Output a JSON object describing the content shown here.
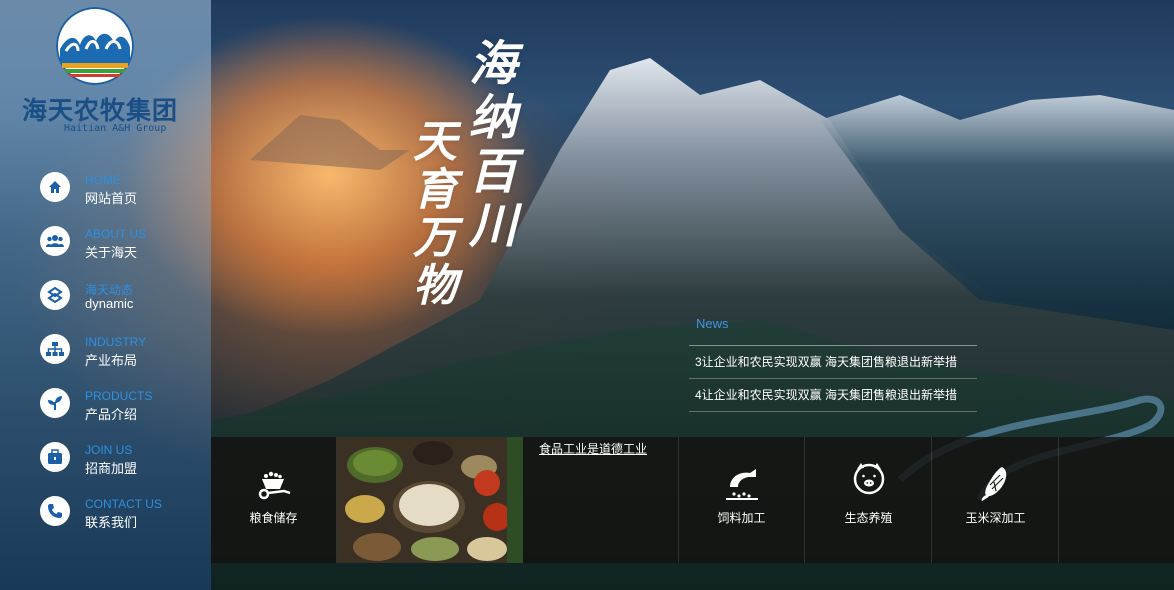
{
  "brand": {
    "name_cn": "海天农牧集团",
    "name_en": "Haitian A&H Group"
  },
  "nav": [
    {
      "en": "HOME",
      "cn": "网站首页",
      "icon": "home-icon"
    },
    {
      "en": "ABOUT US",
      "cn": "关于海天",
      "icon": "users-icon"
    },
    {
      "en": "海天动态",
      "cn": "dynamic",
      "icon": "dynamic-icon"
    },
    {
      "en": "INDUSTRY",
      "cn": "产业布局",
      "icon": "sitemap-icon"
    },
    {
      "en": "PRODUCTS",
      "cn": "产品介绍",
      "icon": "sprout-icon"
    },
    {
      "en": "JOIN US",
      "cn": "招商加盟",
      "icon": "briefcase-icon"
    },
    {
      "en": "CONTACT US",
      "cn": "联系我们",
      "icon": "phone-icon"
    }
  ],
  "calligraphy": {
    "line1": "海纳百川",
    "line2": "天育万物"
  },
  "news": {
    "title": "News",
    "items": [
      "3让企业和农民实现双赢 海天集团售粮退出新举措",
      "4让企业和农民实现双赢 海天集团售粮退出新举措"
    ]
  },
  "strip": {
    "grain": {
      "label": "粮食储存",
      "icon": "wheelbarrow-icon"
    },
    "feature": {
      "title": "食品工业是道德工业"
    },
    "feed": {
      "label": "饲料加工",
      "icon": "feed-machine-icon"
    },
    "eco": {
      "label": "生态养殖",
      "icon": "pig-icon"
    },
    "corn": {
      "label": "玉米深加工",
      "icon": "corn-icon"
    }
  },
  "colors": {
    "accent": "#3f95e3",
    "brand": "#1a4f86"
  }
}
